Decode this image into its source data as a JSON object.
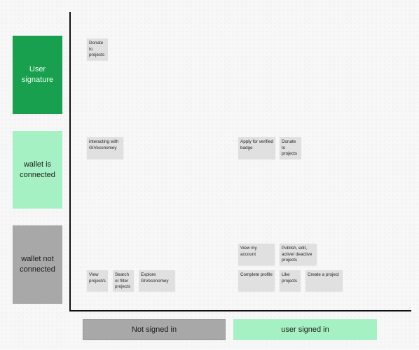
{
  "rows": {
    "user_signature": "User signature",
    "wallet_connected": "wallet is connected",
    "wallet_not_connected": "wallet not connected"
  },
  "columns": {
    "not_signed_in": "Not signed in",
    "user_signed_in": "user signed in"
  },
  "notes": {
    "sig_not_signed": [
      "Donate to projects"
    ],
    "connected_not_signed": [
      "interacting with GIVeconomey"
    ],
    "connected_signed": [
      "Apply for verified badge",
      "Donate to projects"
    ],
    "not_connected_not_signed": [
      "View project/s",
      "Search or filter projects",
      "Explore GIVeconomey"
    ],
    "not_connected_signed": [
      "View my account",
      "Publish, edit, active/ deactive projects",
      "Complete profile",
      "Like projects",
      "Create a project"
    ]
  },
  "colors": {
    "user_signature": "#18a04e",
    "wallet_connected": "#a6f1c3",
    "wallet_not_connected": "#a8a8a8",
    "note": "#e0e0e0"
  }
}
